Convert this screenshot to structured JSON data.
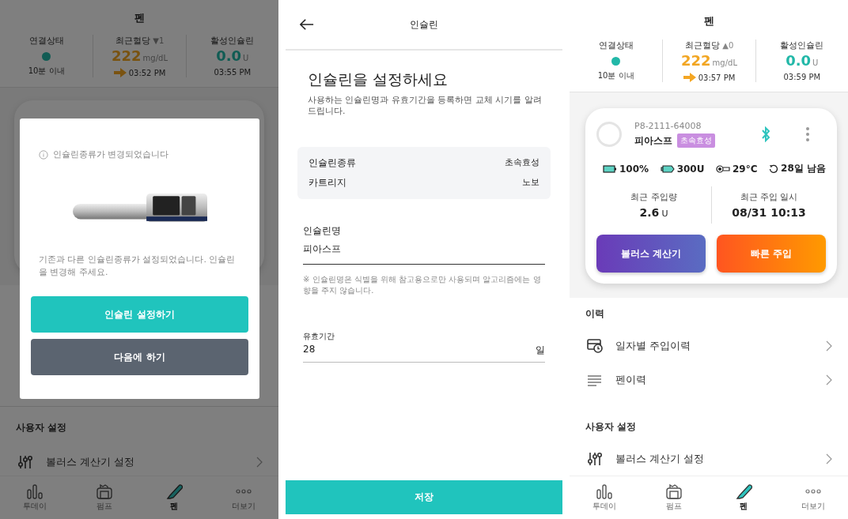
{
  "screens": [
    {
      "kind": "pen_dialog",
      "title": "펜",
      "stats": {
        "connection": {
          "label": "연결상태",
          "connected": true,
          "status": "10분 이내"
        },
        "glucose": {
          "label": "최근혈당",
          "trend": "▼1",
          "value": "222",
          "unit": "mg/dL",
          "time": "03:52 PM"
        },
        "insulin": {
          "label": "활성인슐린",
          "value": "0.0",
          "unit": "U",
          "time": "03:55 PM"
        }
      },
      "dialog": {
        "title": "인슐린종류가 변경되었습니다",
        "message": "기존과 다른 인슐린종류가 설정되었습니다. 인슐린을 변경해 주세요.",
        "buttons": [
          {
            "label": "인슐린 설정하기",
            "kind": "primary"
          },
          {
            "label": "다음에 하기",
            "kind": "secondary"
          }
        ]
      },
      "sections": [
        {
          "title": "사용자 설정",
          "items": [
            {
              "kind": "bolus_settings",
              "label": "볼러스 계산기 설정"
            }
          ]
        }
      ],
      "nav": [
        {
          "label": "투데이",
          "selected": false
        },
        {
          "label": "펌프",
          "selected": false
        },
        {
          "label": "펜",
          "selected": true
        },
        {
          "label": "더보기",
          "selected": false
        }
      ]
    },
    {
      "kind": "insulin_form",
      "title": "인슐린",
      "heading": "인슐린을 설정하세요",
      "description": "사용하는 인슐린명과 유효기간을 등록하면 교체 시기를 알려드립니다.",
      "info": [
        {
          "label": "인슐린종류",
          "value": "초속효성"
        },
        {
          "label": "카트리지",
          "value": "노보"
        }
      ],
      "name_field": {
        "label": "인슐린명",
        "value": "피아스프"
      },
      "note": "※ 인슐린명은 식별을 위해 참고용으로만 사용되며 알고리즘에는 영향을 주지 않습니다.",
      "period_field": {
        "label": "유효기간",
        "value": "28",
        "unit": "일"
      },
      "save": "저장"
    },
    {
      "kind": "pen",
      "title": "펜",
      "stats": {
        "connection": {
          "label": "연결상태",
          "connected": true,
          "status": "10분 이내"
        },
        "glucose": {
          "label": "최근혈당",
          "trend": "▲0",
          "value": "222",
          "unit": "mg/dL",
          "time": "03:57 PM"
        },
        "insulin": {
          "label": "활성인슐린",
          "value": "0.0",
          "unit": "U",
          "time": "03:59 PM"
        }
      },
      "card": {
        "serial": "P8-2111-64008",
        "name": "피아스프",
        "tag": "초속효성",
        "bluetooth": true,
        "status": [
          {
            "kind": "battery",
            "text": "100%"
          },
          {
            "kind": "cartridge",
            "text": "300U"
          },
          {
            "kind": "temperature",
            "text": "29°C"
          },
          {
            "kind": "days",
            "text": "28일 남음"
          }
        ],
        "metrics": [
          {
            "label": "최근 주입량",
            "value": "2.6",
            "unit": "U"
          },
          {
            "label": "최근 주입 일시",
            "value": "08/31 10:13"
          }
        ],
        "buttons": [
          {
            "label": "볼러스 계산기",
            "kind": "bolus"
          },
          {
            "label": "빠른 주입",
            "kind": "quick"
          }
        ]
      },
      "sections": [
        {
          "title": "이력",
          "items": [
            {
              "kind": "daily_history",
              "label": "일자별 주입이력"
            },
            {
              "kind": "pen_history",
              "label": "펜이력"
            }
          ]
        },
        {
          "title": "사용자 설정",
          "items": [
            {
              "kind": "bolus_settings",
              "label": "볼러스 계산기 설정"
            }
          ]
        }
      ],
      "nav": [
        {
          "label": "투데이",
          "selected": false
        },
        {
          "label": "펌프",
          "selected": false
        },
        {
          "label": "펜",
          "selected": true
        },
        {
          "label": "더보기",
          "selected": false
        }
      ]
    }
  ]
}
